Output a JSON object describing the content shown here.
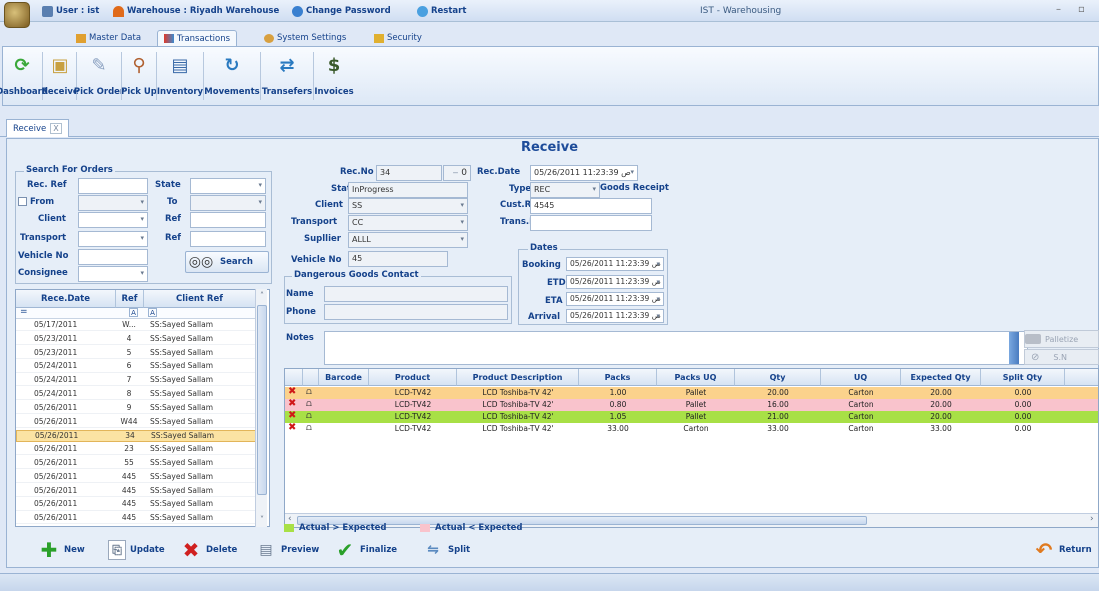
{
  "titlebar": {
    "user": "User : ist",
    "warehouse": "Warehouse : Riyadh Warehouse",
    "change_password": "Change Password",
    "restart": "Restart",
    "window_title": "IST - Warehousing",
    "minimize": "–",
    "maximize": "▫"
  },
  "tabs": [
    {
      "label": "Master Data",
      "icon": "folder-icon"
    },
    {
      "label": "Transactions",
      "icon": "transactions-icon"
    },
    {
      "label": "System Settings",
      "icon": "settings-icon"
    },
    {
      "label": "Security",
      "icon": "security-icon"
    }
  ],
  "ribbon": [
    {
      "label": "Dashboard",
      "icon": "dashboard-icon",
      "color": "#3aa83a"
    },
    {
      "label": "Receive",
      "icon": "receive-icon",
      "color": "#c8a040"
    },
    {
      "label": "Pick Order",
      "icon": "pick-order-icon",
      "color": "#8aa0c0"
    },
    {
      "label": "Pick Up",
      "icon": "pick-up-icon",
      "color": "#b06030"
    },
    {
      "label": "Inventory",
      "icon": "inventory-icon",
      "color": "#3a6aa8"
    },
    {
      "label": "Movements",
      "icon": "movements-icon",
      "color": "#2a7ac0"
    },
    {
      "label": "Transefers",
      "icon": "transfers-icon",
      "color": "#2a7ac0"
    },
    {
      "label": "Invoices",
      "icon": "invoices-icon",
      "color": "#3a5a2a"
    }
  ],
  "doc_tab": {
    "label": "Receive",
    "close": "X"
  },
  "form_title": "Receive",
  "search": {
    "title": "Search For Orders",
    "rec_ref_label": "Rec. Ref",
    "state_label": "State",
    "from_label": "From",
    "to_label": "To",
    "client_label": "Client",
    "ref_label": "Ref",
    "transport_label": "Transport",
    "ref2_label": "Ref",
    "vehicle_label": "Vehicle No",
    "consignee_label": "Consignee",
    "search_button": "Search"
  },
  "left_grid": {
    "headers": [
      "Rece.Date",
      "Ref",
      "Client Ref"
    ],
    "filter_first": "=",
    "filter_icon": "A",
    "rows": [
      {
        "date": "05/17/2011",
        "ref": "W...",
        "client": "SS:Sayed Sallam"
      },
      {
        "date": "05/23/2011",
        "ref": "4",
        "client": "SS:Sayed Sallam"
      },
      {
        "date": "05/23/2011",
        "ref": "5",
        "client": "SS:Sayed Sallam"
      },
      {
        "date": "05/24/2011",
        "ref": "6",
        "client": "SS:Sayed Sallam"
      },
      {
        "date": "05/24/2011",
        "ref": "7",
        "client": "SS:Sayed Sallam"
      },
      {
        "date": "05/24/2011",
        "ref": "8",
        "client": "SS:Sayed Sallam"
      },
      {
        "date": "05/26/2011",
        "ref": "9",
        "client": "SS:Sayed Sallam"
      },
      {
        "date": "05/26/2011",
        "ref": "W44",
        "client": "SS:Sayed Sallam"
      },
      {
        "date": "05/26/2011",
        "ref": "34",
        "client": "SS:Sayed Sallam"
      },
      {
        "date": "05/26/2011",
        "ref": "23",
        "client": "SS:Sayed Sallam"
      },
      {
        "date": "05/26/2011",
        "ref": "55",
        "client": "SS:Sayed Sallam"
      },
      {
        "date": "05/26/2011",
        "ref": "445",
        "client": "SS:Sayed Sallam"
      },
      {
        "date": "05/26/2011",
        "ref": "445",
        "client": "SS:Sayed Sallam"
      },
      {
        "date": "05/26/2011",
        "ref": "445",
        "client": "SS:Sayed Sallam"
      },
      {
        "date": "05/26/2011",
        "ref": "445",
        "client": "SS:Sayed Sallam"
      }
    ],
    "selected_index": 8
  },
  "details": {
    "rec_no_label": "Rec.No",
    "rec_no": "34",
    "rec_no_extra": "0",
    "rec_date_label": "Rec.Date",
    "rec_date": "05/26/2011 11:23:39 ص",
    "status_label": "Status",
    "status": "InProgress",
    "type_label": "Type:",
    "type": "REC",
    "type_desc": "Goods Receipt",
    "client_label": "Client",
    "client": "SS",
    "cust_ref_label": "Cust.Ref:",
    "cust_ref": "4545",
    "transport_label": "Transport",
    "transport": "CC",
    "trans_ref_label": "Trans.Ref",
    "trans_ref": "",
    "supplier_label": "Supllier",
    "supplier": "ALLL",
    "vehicle_label": "Vehicle No",
    "vehicle": "45",
    "dangerous_title": "Dangerous Goods Contact",
    "name_label": "Name",
    "phone_label": "Phone",
    "notes_label": "Notes",
    "dates_title": "Dates",
    "booking_label": "Booking",
    "booking": "05/26/2011 11:23:39 ص",
    "etd_label": "ETD",
    "etd": "05/26/2011 11:23:39 ص",
    "eta_label": "ETA",
    "eta": "05/26/2011 11:23:39 ص",
    "arrival_label": "Arrival",
    "arrival": "05/26/2011 11:23:39 ص",
    "palletize": "Palletize",
    "sn": "S.N"
  },
  "right_grid": {
    "headers": [
      "Barcode",
      "Product",
      "Product Description",
      "Packs",
      "Packs UQ",
      "Qty",
      "UQ",
      "Expected Qty",
      "Split Qty"
    ],
    "rows": [
      {
        "barcode": "",
        "product": "LCD-TV42",
        "desc": "LCD Toshiba-TV 42'",
        "packs": "1.00",
        "packs_uq": "Pallet",
        "qty": "20.00",
        "uq": "Carton",
        "expected": "20.00",
        "split": "0.00",
        "color": "#fbd28c"
      },
      {
        "barcode": "",
        "product": "LCD-TV42",
        "desc": "LCD Toshiba-TV 42'",
        "packs": "0.80",
        "packs_uq": "Pallet",
        "qty": "16.00",
        "uq": "Carton",
        "expected": "20.00",
        "split": "0.00",
        "color": "#f9c3cc"
      },
      {
        "barcode": "",
        "product": "LCD-TV42",
        "desc": "LCD Toshiba-TV 42'",
        "packs": "1.05",
        "packs_uq": "Pallet",
        "qty": "21.00",
        "uq": "Carton",
        "expected": "20.00",
        "split": "0.00",
        "color": "#a8e046"
      },
      {
        "barcode": "",
        "product": "LCD-TV42",
        "desc": "LCD Toshiba-TV 42'",
        "packs": "33.00",
        "packs_uq": "Carton",
        "qty": "33.00",
        "uq": "Carton",
        "expected": "33.00",
        "split": "0.00",
        "color": "#ffffff"
      }
    ]
  },
  "legend": {
    "greater": "Actual > Expected",
    "greater_color": "#a8e046",
    "less": "Actual < Expected",
    "less_color": "#f9c3cc"
  },
  "buttons": {
    "new": "New",
    "update": "Update",
    "delete": "Delete",
    "preview": "Preview",
    "finalize": "Finalize",
    "split": "Split",
    "return": "Return"
  }
}
